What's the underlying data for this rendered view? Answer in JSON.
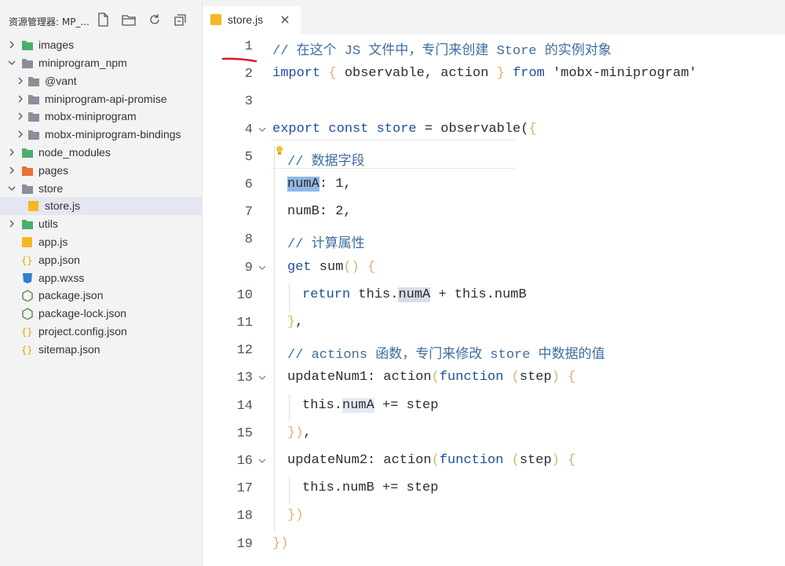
{
  "explorer": {
    "title": "资源管理器: MP_...",
    "header_icons": [
      "new-file-icon",
      "new-folder-icon",
      "refresh-icon",
      "collapse-all-icon"
    ],
    "items": [
      {
        "label": "images",
        "kind": "folder-green",
        "expanded": false
      },
      {
        "label": "miniprogram_npm",
        "kind": "folder-gray",
        "expanded": true
      },
      {
        "label": "@vant",
        "kind": "folder-gray",
        "expanded": false
      },
      {
        "label": "miniprogram-api-promise",
        "kind": "folder-gray",
        "expanded": false
      },
      {
        "label": "mobx-miniprogram",
        "kind": "folder-gray",
        "expanded": false
      },
      {
        "label": "mobx-miniprogram-bindings",
        "kind": "folder-gray",
        "expanded": false
      },
      {
        "label": "node_modules",
        "kind": "folder-green",
        "expanded": false
      },
      {
        "label": "pages",
        "kind": "folder-orange",
        "expanded": false
      },
      {
        "label": "store",
        "kind": "folder-gray",
        "expanded": true
      },
      {
        "label": "store.js",
        "kind": "js-file",
        "selected": true
      },
      {
        "label": "utils",
        "kind": "folder-green",
        "expanded": false
      },
      {
        "label": "app.js",
        "kind": "js-file"
      },
      {
        "label": "app.json",
        "kind": "json-file"
      },
      {
        "label": "app.wxss",
        "kind": "css-file"
      },
      {
        "label": "package.json",
        "kind": "npm-file"
      },
      {
        "label": "package-lock.json",
        "kind": "npm-file"
      },
      {
        "label": "project.config.json",
        "kind": "json-file"
      },
      {
        "label": "sitemap.json",
        "kind": "json-file"
      }
    ]
  },
  "tabs": [
    {
      "label": "store.js",
      "close": "×",
      "active": true
    }
  ],
  "editor": {
    "lines": [
      {
        "n": "1",
        "tokens": [
          {
            "t": "// 在这个 JS 文件中，专门来创建 Store 的实例对象",
            "c": "comment"
          }
        ]
      },
      {
        "n": "2",
        "tokens": [
          {
            "t": "import",
            "c": "kw"
          },
          {
            "t": " ",
            "c": "plain"
          },
          {
            "t": "{",
            "c": "brace"
          },
          {
            "t": " observable, action ",
            "c": "plain"
          },
          {
            "t": "}",
            "c": "brace"
          },
          {
            "t": " ",
            "c": "plain"
          },
          {
            "t": "from",
            "c": "kw"
          },
          {
            "t": " 'mobx-miniprogram'",
            "c": "str"
          }
        ]
      },
      {
        "n": "3",
        "tokens": []
      },
      {
        "n": "4",
        "fold": true,
        "tokens": [
          {
            "t": "export const store",
            "c": "kw"
          },
          {
            "t": " = observable(",
            "c": "plain"
          },
          {
            "t": "{",
            "c": "brace"
          }
        ]
      },
      {
        "n": "5",
        "tokens": [
          {
            "t": "// 数据字段",
            "c": "comment"
          }
        ]
      },
      {
        "n": "6",
        "tokens": [
          {
            "t": "numA",
            "c": "sel"
          },
          {
            "t": ": 1,",
            "c": "plain"
          }
        ]
      },
      {
        "n": "7",
        "tokens": [
          {
            "t": "numB: 2,",
            "c": "plain"
          }
        ]
      },
      {
        "n": "8",
        "tokens": [
          {
            "t": "// 计算属性",
            "c": "comment"
          }
        ]
      },
      {
        "n": "9",
        "fold": true,
        "tokens": [
          {
            "t": "get",
            "c": "kw"
          },
          {
            "t": " sum",
            "c": "plain"
          },
          {
            "t": "()",
            "c": "brace"
          },
          {
            "t": " ",
            "c": "plain"
          },
          {
            "t": "{",
            "c": "brace"
          }
        ]
      },
      {
        "n": "10",
        "tokens": [
          {
            "t": "return",
            "c": "kw"
          },
          {
            "t": " this.",
            "c": "plain"
          },
          {
            "t": "numA",
            "c": "ref"
          },
          {
            "t": " + this.numB",
            "c": "plain"
          }
        ]
      },
      {
        "n": "11",
        "tokens": [
          {
            "t": "}",
            "c": "brace"
          },
          {
            "t": ",",
            "c": "plain"
          }
        ]
      },
      {
        "n": "12",
        "tokens": [
          {
            "t": "// actions 函数，专门来修改 store 中数据的值",
            "c": "comment"
          }
        ]
      },
      {
        "n": "13",
        "fold": true,
        "tokens": [
          {
            "t": "updateNum1: action",
            "c": "plain"
          },
          {
            "t": "(",
            "c": "brace"
          },
          {
            "t": "function",
            "c": "kw"
          },
          {
            "t": " ",
            "c": "plain"
          },
          {
            "t": "(",
            "c": "brace"
          },
          {
            "t": "step",
            "c": "plain"
          },
          {
            "t": ")",
            "c": "brace"
          },
          {
            "t": " ",
            "c": "plain"
          },
          {
            "t": "{",
            "c": "brace"
          }
        ]
      },
      {
        "n": "14",
        "tokens": [
          {
            "t": "this.",
            "c": "plain"
          },
          {
            "t": "numA",
            "c": "ref2"
          },
          {
            "t": " += step",
            "c": "plain"
          }
        ]
      },
      {
        "n": "15",
        "tokens": [
          {
            "t": "})",
            "c": "brace"
          },
          {
            "t": ",",
            "c": "plain"
          }
        ]
      },
      {
        "n": "16",
        "fold": true,
        "tokens": [
          {
            "t": "updateNum2: action",
            "c": "plain"
          },
          {
            "t": "(",
            "c": "brace"
          },
          {
            "t": "function",
            "c": "kw"
          },
          {
            "t": " ",
            "c": "plain"
          },
          {
            "t": "(",
            "c": "brace"
          },
          {
            "t": "step",
            "c": "plain"
          },
          {
            "t": ")",
            "c": "brace"
          },
          {
            "t": " ",
            "c": "plain"
          },
          {
            "t": "{",
            "c": "brace"
          }
        ]
      },
      {
        "n": "17",
        "tokens": [
          {
            "t": "this.numB += step",
            "c": "plain"
          }
        ]
      },
      {
        "n": "18",
        "tokens": [
          {
            "t": "})",
            "c": "brace"
          }
        ]
      },
      {
        "n": "19",
        "tokens": [
          {
            "t": "})",
            "c": "brace"
          }
        ]
      }
    ]
  },
  "colors": {
    "sidebar_bg": "#f3f3f3",
    "selected_row": "#e4e6f1",
    "keyword": "#1e4fa0",
    "comment": "#3f6d9e",
    "brace": "#d5b46a",
    "selection": "#90b8e8",
    "annotation_underline": "#e0182a"
  }
}
